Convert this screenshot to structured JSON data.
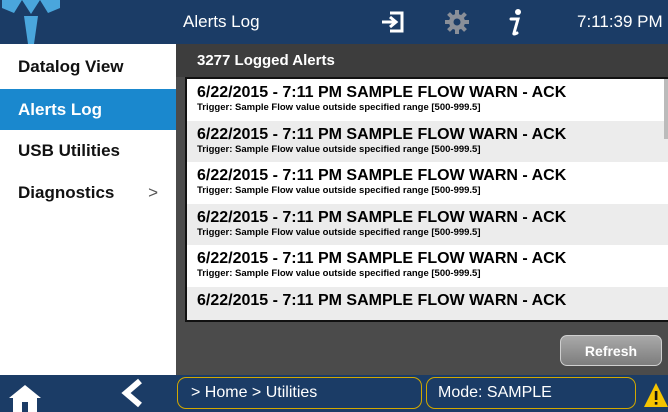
{
  "header": {
    "title": "Alerts Log",
    "clock": "7:11:39 PM",
    "icons": [
      "logo-icon",
      "exit-icon",
      "gear-icon",
      "info-icon"
    ]
  },
  "sidebar": {
    "items": [
      {
        "label": "Datalog View",
        "active": false
      },
      {
        "label": "Alerts Log",
        "active": true
      },
      {
        "label": "USB Utilities",
        "active": false
      },
      {
        "label": "Diagnostics",
        "active": false,
        "chevron": ">"
      }
    ]
  },
  "main": {
    "count_label": "3277 Logged Alerts",
    "alerts": [
      {
        "title": "6/22/2015 - 7:11 PM SAMPLE FLOW WARN - ACK",
        "detail": "Trigger: Sample Flow value outside specified range [500-999.5]"
      },
      {
        "title": "6/22/2015 - 7:11 PM SAMPLE FLOW WARN - ACK",
        "detail": "Trigger: Sample Flow value outside specified range [500-999.5]"
      },
      {
        "title": "6/22/2015 - 7:11 PM SAMPLE FLOW WARN - ACK",
        "detail": "Trigger: Sample Flow value outside specified range [500-999.5]"
      },
      {
        "title": "6/22/2015 - 7:11 PM SAMPLE FLOW WARN - ACK",
        "detail": "Trigger: Sample Flow value outside specified range [500-999.5]"
      },
      {
        "title": "6/22/2015 - 7:11 PM SAMPLE FLOW WARN - ACK",
        "detail": "Trigger: Sample Flow value outside specified range [500-999.5]"
      },
      {
        "title": "6/22/2015 - 7:11 PM SAMPLE FLOW WARN - ACK",
        "detail": ""
      }
    ],
    "refresh_label": "Refresh"
  },
  "footer": {
    "breadcrumb": "> Home > Utilities",
    "mode": "Mode: SAMPLE",
    "icons": [
      "home-icon",
      "back-icon",
      "warning-icon"
    ]
  },
  "colors": {
    "chrome": "#1b3c66",
    "accent": "#1a88ce",
    "panel": "#4b4b4b",
    "border_highlight": "#d2a800",
    "warning": "#f5c400"
  }
}
